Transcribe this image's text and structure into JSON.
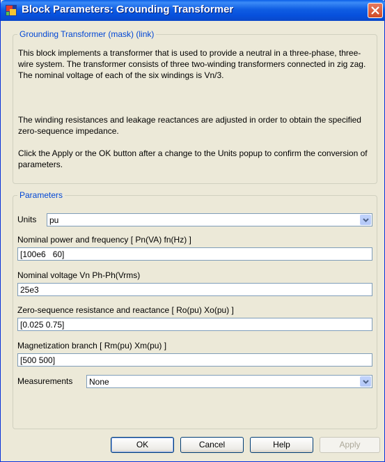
{
  "window": {
    "title": "Block Parameters: Grounding Transformer"
  },
  "description_group": {
    "legend": "Grounding Transformer (mask) (link)",
    "paragraph1": "This block implements a transformer that is used to provide a neutral in a three-phase, three-wire  system. The transformer consists of three two-winding transformers connected in zig zag. The nominal voltage of each of the six windings is Vn/3.",
    "paragraph2": "The winding resistances and leakage reactances are adjusted in order to obtain the specified zero-sequence impedance.",
    "paragraph3": "Click the Apply or the OK button after a change to the Units popup to confirm the conversion of parameters."
  },
  "parameters_group": {
    "legend": "Parameters",
    "units": {
      "label": "Units",
      "selected": "pu"
    },
    "nominal_power": {
      "label": "Nominal power and frequency [ Pn(VA)  fn(Hz) ]",
      "value": "[100e6   60]"
    },
    "nominal_voltage": {
      "label": "Nominal voltage Vn Ph-Ph(Vrms)",
      "value": "25e3"
    },
    "zero_sequence": {
      "label": "Zero-sequence resistance and reactance [ Ro(pu)  Xo(pu) ]",
      "value": "[0.025 0.75]"
    },
    "magnetization": {
      "label": "Magnetization  branch [ Rm(pu)  Xm(pu) ]",
      "value": "[500 500]"
    },
    "measurements": {
      "label": "Measurements",
      "selected": "None"
    }
  },
  "buttons": {
    "ok": "OK",
    "cancel": "Cancel",
    "help": "Help",
    "apply": "Apply"
  },
  "colors": {
    "titlebar": "#0a5fe8",
    "legend_text": "#0046d5",
    "dialog_bg": "#ece9d8",
    "close_button": "#d14a26"
  },
  "icons": {
    "app": "simulink-block-icon",
    "close": "close-icon",
    "dropdown": "chevron-down-icon"
  }
}
